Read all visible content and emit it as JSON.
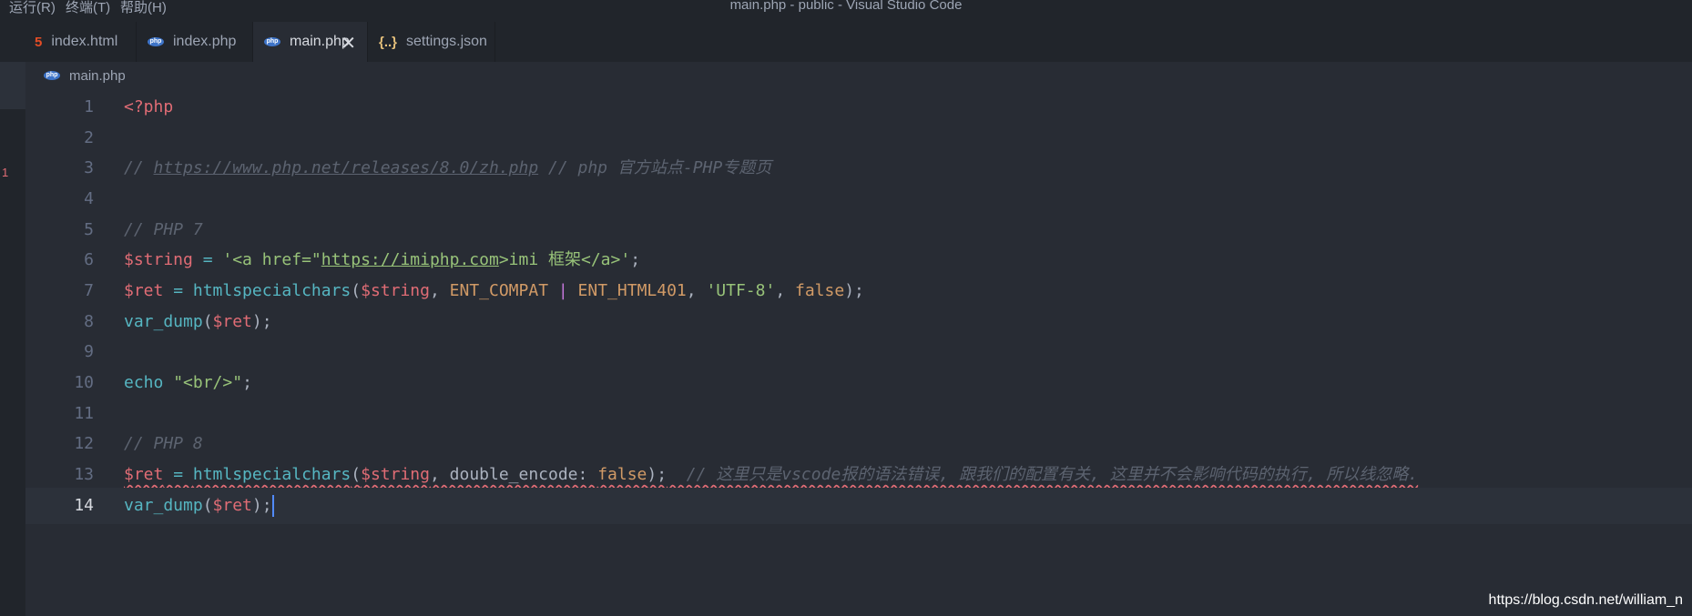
{
  "window": {
    "title": "main.php - public - Visual Studio Code",
    "menu": [
      "运行(R)",
      "终端(T)",
      "帮助(H)"
    ]
  },
  "tabs": [
    {
      "label": "index.html",
      "icon": "html-icon"
    },
    {
      "label": "index.php",
      "icon": "php-icon"
    },
    {
      "label": "main.php",
      "icon": "php-icon",
      "active": true,
      "close": "✕"
    },
    {
      "label": "settings.json",
      "icon": "json-icon"
    }
  ],
  "icons": {
    "html": "5",
    "php": "php",
    "json": "{..}"
  },
  "breadcrumb": {
    "file": "main.php"
  },
  "gutter_marker": "1",
  "editor": {
    "current_line": 14,
    "lines": [
      {
        "n": "1"
      },
      {
        "n": "2"
      },
      {
        "n": "3"
      },
      {
        "n": "4"
      },
      {
        "n": "5"
      },
      {
        "n": "6"
      },
      {
        "n": "7"
      },
      {
        "n": "8"
      },
      {
        "n": "9"
      },
      {
        "n": "10"
      },
      {
        "n": "11"
      },
      {
        "n": "12"
      },
      {
        "n": "13"
      },
      {
        "n": "14"
      }
    ],
    "code": {
      "l1": "<?php",
      "l3_a": "// ",
      "l3_url": "https://www.php.net/releases/8.0/zh.php",
      "l3_b": " // php 官方站点-PHP专题页",
      "l5": "// PHP 7",
      "l6_var": "$string",
      "l6_eq": " = ",
      "l6_s1": "'<a href=\"",
      "l6_url": "https://imiphp.com",
      "l6_s2": ">imi 框架</a>'",
      "l6_end": ";",
      "l7_var": "$ret",
      "l7_eq": " = ",
      "l7_fn": "htmlspecialchars",
      "l7_p1": "(",
      "l7_arg": "$string",
      "l7_c1": ", ",
      "l7_k1": "ENT_COMPAT",
      "l7_bar": " | ",
      "l7_k2": "ENT_HTML401",
      "l7_c2": ", ",
      "l7_s": "'UTF-8'",
      "l7_c3": ", ",
      "l7_f": "false",
      "l7_end": ");",
      "l8_fn": "var_dump",
      "l8_p1": "(",
      "l8_var": "$ret",
      "l8_end": ");",
      "l10_fn": "echo",
      "l10_sp": " ",
      "l10_s": "\"<br/>\"",
      "l10_end": ";",
      "l12": "// PHP 8",
      "l13_var": "$ret",
      "l13_eq": " = ",
      "l13_fn": "htmlspecialchars",
      "l13_p1": "(",
      "l13_arg": "$string",
      "l13_c1": ", double_encode: ",
      "l13_f": "false",
      "l13_end": ");",
      "l13_cmt": "  // 这里只是vscode报的语法错误, 跟我们的配置有关, 这里并不会影响代码的执行, 所以线忽略.",
      "l14_fn": "var_dump",
      "l14_p1": "(",
      "l14_var": "$ret",
      "l14_end": ");"
    }
  },
  "watermark": "https://blog.csdn.net/william_n",
  "colors": {
    "background": "#282c34",
    "variable": "#e06c75",
    "function": "#56b6c2",
    "constant": "#d19a66",
    "string": "#98c379",
    "comment": "#5c6370",
    "error_squiggle": "#e06c75"
  }
}
